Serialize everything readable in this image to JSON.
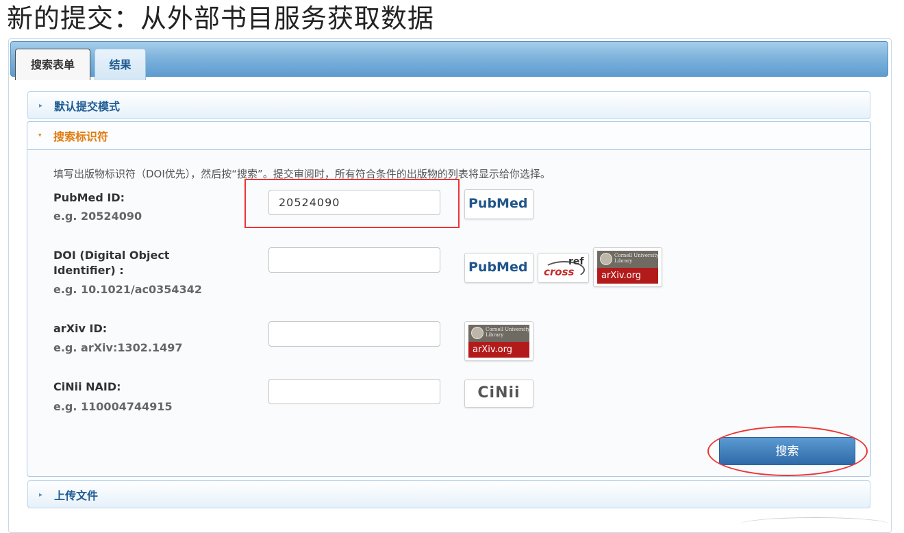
{
  "page": {
    "title": "新的提交：从外部书目服务获取数据"
  },
  "tabs": [
    {
      "label": "搜索表单",
      "active": true
    },
    {
      "label": "结果",
      "active": false
    }
  ],
  "accordion": {
    "default_mode": {
      "label": "默认提交模式",
      "arrow": "▸"
    },
    "search_ids": {
      "label": "搜索标识符",
      "arrow": "▾"
    },
    "upload_file": {
      "label": "上传文件",
      "arrow": "▸"
    }
  },
  "intro_text": "填写出版物标识符（DOI优先），然后按“搜索”。提交审阅时，所有符合条件的出版物的列表将显示给你选择。",
  "fields": {
    "pubmed": {
      "label": "PubMed ID:",
      "hint": "e.g. 20524090",
      "value": "20524090",
      "placeholder": ""
    },
    "doi": {
      "label": "DOI (Digital Object Identifier) :",
      "hint": "e.g. 10.1021/ac0354342",
      "value": "",
      "placeholder": ""
    },
    "arxiv": {
      "label": "arXiv ID:",
      "hint": "e.g. arXiv:1302.1497",
      "value": "",
      "placeholder": ""
    },
    "cinii": {
      "label": "CiNii NAID:",
      "hint": "e.g. 110004744915",
      "value": "",
      "placeholder": ""
    }
  },
  "logos": {
    "pubmed_text": "PubMed",
    "crossref_cross": "cross",
    "crossref_ref": "ref",
    "arxiv_library": "Cornell University Library",
    "arxiv_site": "arXiv.org",
    "cinii_text": "CiNii"
  },
  "search_button": {
    "label": "搜索"
  },
  "colors": {
    "tab_bar": "#6fa8d8",
    "accordion_text": "#1e5c94",
    "active_section_text": "#e07d10",
    "button": "#3a78b8",
    "highlight": "#e33333"
  }
}
